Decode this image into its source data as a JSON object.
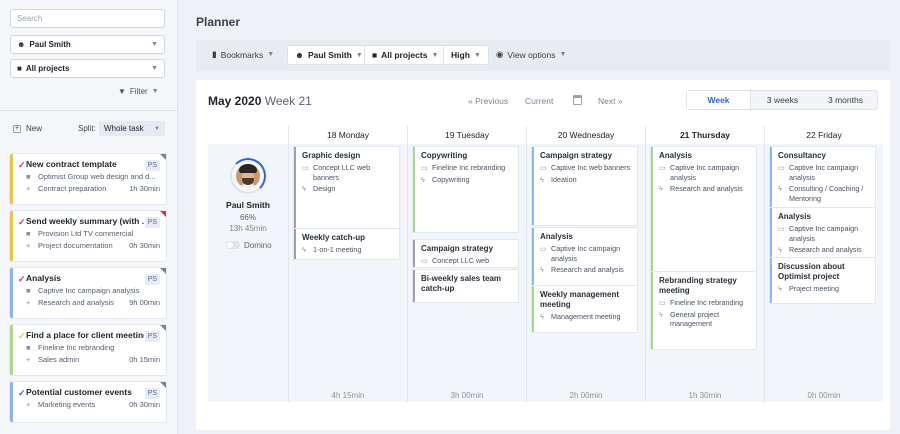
{
  "sidebar": {
    "search_placeholder": "Search",
    "user_select": "Paul Smith",
    "project_select": "All projects",
    "filter_label": "Filter",
    "new_label": "New",
    "split_label": "Split:",
    "split_value": "Whole task",
    "tasks": [
      {
        "title": "New contract template",
        "badge": "PS",
        "check_color": "#e0334a",
        "border_color": "#e8c54a",
        "corner_color": "#7a8190",
        "rows": [
          {
            "icon": "■",
            "text": "Optimist Group web design and d...",
            "time": ""
          },
          {
            "icon": "+",
            "text": "Contract preparation",
            "time": "1h 30min"
          }
        ]
      },
      {
        "title": "Send weekly summary (with ...",
        "badge": "PS",
        "check_color": "#e0334a",
        "border_color": "#e8c54a",
        "corner_color": "#e0334a",
        "rows": [
          {
            "icon": "■",
            "text": "Provision Ltd TV commercial",
            "time": ""
          },
          {
            "icon": "+",
            "text": "Project documentation",
            "time": "0h 30min"
          }
        ]
      },
      {
        "title": "Analysis",
        "badge": "PS",
        "check_color": "#e0334a",
        "border_color": "#8fb6e8",
        "corner_color": "#7a8190",
        "rows": [
          {
            "icon": "■",
            "text": "Captive Inc campaign analysis",
            "time": ""
          },
          {
            "icon": "+",
            "text": "Research and analysis",
            "time": "9h 00min"
          }
        ]
      },
      {
        "title": "Find a place for client meetings",
        "badge": "PS",
        "check_color": "#e8c54a",
        "border_color": "#a8d88a",
        "corner_color": "#7a8190",
        "rows": [
          {
            "icon": "■",
            "text": "Fineline Inc rebranding",
            "time": ""
          },
          {
            "icon": "+",
            "text": "Sales admin",
            "time": "0h 15min"
          }
        ]
      },
      {
        "title": "Potential customer events",
        "badge": "PS",
        "check_color": "#2f66d6",
        "border_color": "#8fb6e8",
        "corner_color": "#7a8190",
        "rows": [
          {
            "icon": "+",
            "text": "Marketing events",
            "time": "0h 30min"
          }
        ]
      }
    ]
  },
  "main": {
    "title": "Planner",
    "toolbar": {
      "bookmarks": "Bookmarks",
      "user": "Paul Smith",
      "projects": "All projects",
      "priority": "High",
      "view_options": "View options"
    },
    "calendar": {
      "month": "May 2020",
      "week": "Week 21",
      "prev": "« Previous",
      "current": "Current",
      "next": "Next »",
      "views": [
        "Week",
        "3 weeks",
        "3 months"
      ],
      "active_view": "Week"
    },
    "days": [
      {
        "label": "18 Monday",
        "total": "4h 15min",
        "today": false
      },
      {
        "label": "19 Tuesday",
        "total": "3h 00min",
        "today": false
      },
      {
        "label": "20 Wednesday",
        "total": "2h 00min",
        "today": false
      },
      {
        "label": "21 Thursday",
        "total": "1h 30min",
        "today": true
      },
      {
        "label": "22 Friday",
        "total": "0h 00min",
        "today": false
      }
    ],
    "person": {
      "name": "Paul Smith",
      "percent": "66%",
      "hours": "13h 45min",
      "toggle_label": "Domino"
    },
    "events": [
      {
        "day": 0,
        "title": "Graphic design",
        "project": "Concept LLC web banners",
        "task": "Design",
        "accent": "#9aa2b0"
      },
      {
        "day": 0,
        "title": "Weekly catch-up",
        "project": "",
        "task": "1-on-1 meeting",
        "accent": "#9aa2b0"
      },
      {
        "day": 1,
        "title": "Copywriting",
        "project": "Fineline Inc rebranding",
        "task": "Copywriting",
        "accent": "#a8d88a"
      },
      {
        "day": 1,
        "title": "Campaign strategy",
        "project": "Concept LLC web",
        "task": "",
        "accent": "#9aa2b0"
      },
      {
        "day": 1,
        "title": "Bi-weekly sales team catch-up",
        "project": "",
        "task": "",
        "accent": "#9aa2b0"
      },
      {
        "day": 2,
        "title": "Campaign strategy",
        "project": "Captive Inc web banners",
        "task": "Ideation",
        "accent": "#8fb6e8"
      },
      {
        "day": 2,
        "title": "Analysis",
        "project": "Captive Inc campaign analysis",
        "task": "Research and analysis",
        "accent": "#8fb6e8"
      },
      {
        "day": 2,
        "title": "Weekly management meeting",
        "project": "",
        "task": "Management meeting",
        "accent": "#a8d88a"
      },
      {
        "day": 3,
        "title": "Analysis",
        "project": "Captive Inc campaign analysis",
        "task": "Research and analysis",
        "accent": "#a8d88a"
      },
      {
        "day": 3,
        "title": "Rebranding strategy meeting",
        "project": "Fineline Inc rebranding",
        "task": "General project management",
        "accent": "#a8d88a"
      },
      {
        "day": 4,
        "title": "Consultancy",
        "project": "Captive Inc campaign analysis",
        "task": "Consulting / Coaching / Mentoring",
        "accent": "#8fb6e8"
      },
      {
        "day": 4,
        "title": "Analysis",
        "project": "Captive Inc campaign analysis",
        "task": "Research and analysis",
        "accent": "#8fb6e8"
      },
      {
        "day": 4,
        "title": "Discussion about Optimist project",
        "project": "",
        "task": "Project meeting",
        "accent": "#8fb6e8"
      }
    ]
  },
  "colors": {
    "accent": "#2f66d6",
    "flag_red": "#e0334a"
  }
}
